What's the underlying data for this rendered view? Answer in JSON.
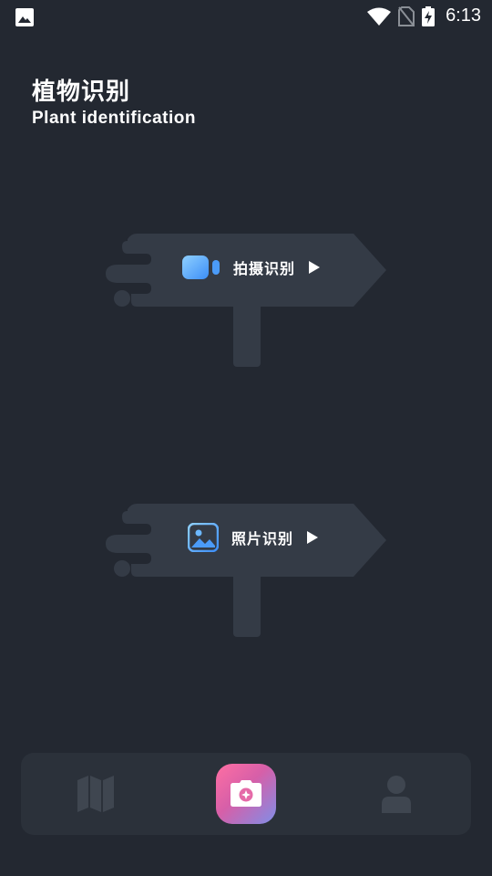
{
  "status_bar": {
    "time": "6:13",
    "icons": [
      "gallery-notification-icon",
      "wifi-icon",
      "no-sim-icon",
      "battery-charging-icon"
    ]
  },
  "header": {
    "title": "植物识别",
    "subtitle": "Plant identification"
  },
  "options": [
    {
      "label": "拍摄识别",
      "icon": "video-camera-icon",
      "arrow": "play-arrow-icon"
    },
    {
      "label": "照片识别",
      "icon": "photo-icon",
      "arrow": "play-arrow-icon"
    }
  ],
  "bottom_nav": {
    "items": [
      "map-icon",
      "camera-icon",
      "user-icon"
    ],
    "active": "camera-icon"
  },
  "colors": {
    "background": "#232831",
    "sign": "#343b46",
    "icon_blue": "#5aaeff",
    "nav_inactive": "#3f4650"
  }
}
